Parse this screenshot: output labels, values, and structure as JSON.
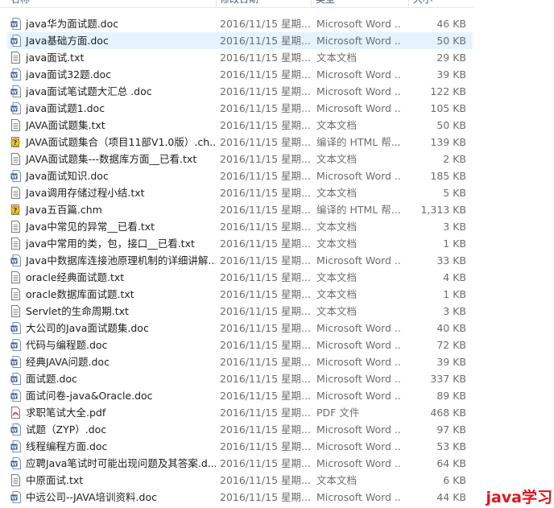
{
  "header": {
    "name_label": "名称",
    "date_label": "修改日期",
    "type_label": "类型",
    "size_label": "大小"
  },
  "files": [
    {
      "name": "java华为面试题.doc",
      "date": "2016/11/15 星期...",
      "type": "Microsoft Word ...",
      "size": "46 KB",
      "icon": "word-doc-icon",
      "selected": false
    },
    {
      "name": "Java基础方面.doc",
      "date": "2016/11/15 星期...",
      "type": "Microsoft Word ...",
      "size": "50 KB",
      "icon": "word-doc-icon",
      "selected": true
    },
    {
      "name": "java面试.txt",
      "date": "2016/11/15 星期...",
      "type": "文本文档",
      "size": "29 KB",
      "icon": "text-file-icon",
      "selected": false
    },
    {
      "name": "java面试32题.doc",
      "date": "2016/11/15 星期...",
      "type": "Microsoft Word ...",
      "size": "39 KB",
      "icon": "word-doc-icon",
      "selected": false
    },
    {
      "name": "java面试笔试题大汇总 .doc",
      "date": "2016/11/15 星期...",
      "type": "Microsoft Word ...",
      "size": "122 KB",
      "icon": "word-doc-icon",
      "selected": false
    },
    {
      "name": "java面试题1.doc",
      "date": "2016/11/15 星期...",
      "type": "Microsoft Word ...",
      "size": "105 KB",
      "icon": "word-doc-icon",
      "selected": false
    },
    {
      "name": "JAVA面试题集.txt",
      "date": "2016/11/15 星期...",
      "type": "文本文档",
      "size": "50 KB",
      "icon": "text-file-icon",
      "selected": false
    },
    {
      "name": "JAVA面试题集合（项目11部V1.0版）.ch...",
      "date": "2016/11/15 星期...",
      "type": "编译的 HTML 帮...",
      "size": "139 KB",
      "icon": "chm-help-icon",
      "selected": false
    },
    {
      "name": "JAVA面试题集---数据库方面__已看.txt",
      "date": "2016/11/15 星期...",
      "type": "文本文档",
      "size": "2 KB",
      "icon": "text-file-icon",
      "selected": false
    },
    {
      "name": "Java面试知识.doc",
      "date": "2016/11/15 星期...",
      "type": "Microsoft Word ...",
      "size": "185 KB",
      "icon": "word-doc-icon",
      "selected": false
    },
    {
      "name": "Java调用存储过程小结.txt",
      "date": "2016/11/15 星期...",
      "type": "文本文档",
      "size": "5 KB",
      "icon": "text-file-icon",
      "selected": false
    },
    {
      "name": "Java五百篇.chm",
      "date": "2016/11/15 星期...",
      "type": "编译的 HTML 帮...",
      "size": "1,313 KB",
      "icon": "chm-help-icon",
      "selected": false
    },
    {
      "name": "Java中常见的异常__已看.txt",
      "date": "2016/11/15 星期...",
      "type": "文本文档",
      "size": "3 KB",
      "icon": "text-file-icon",
      "selected": false
    },
    {
      "name": "java中常用的类，包，接口__已看.txt",
      "date": "2016/11/15 星期...",
      "type": "文本文档",
      "size": "1 KB",
      "icon": "text-file-icon",
      "selected": false
    },
    {
      "name": "Java中数据库连接池原理机制的详细讲解...",
      "date": "2016/11/15 星期...",
      "type": "Microsoft Word ...",
      "size": "33 KB",
      "icon": "word-doc-icon",
      "selected": false
    },
    {
      "name": "oracle经典面试题.txt",
      "date": "2016/11/15 星期...",
      "type": "文本文档",
      "size": "4 KB",
      "icon": "text-file-icon",
      "selected": false
    },
    {
      "name": "oracle数据库面试题.txt",
      "date": "2016/11/15 星期...",
      "type": "文本文档",
      "size": "1 KB",
      "icon": "text-file-icon",
      "selected": false
    },
    {
      "name": "Servlet的生命周期.txt",
      "date": "2016/11/15 星期...",
      "type": "文本文档",
      "size": "3 KB",
      "icon": "text-file-icon",
      "selected": false
    },
    {
      "name": "大公司的Java面试题集.doc",
      "date": "2016/11/15 星期...",
      "type": "Microsoft Word ...",
      "size": "40 KB",
      "icon": "word-doc-icon",
      "selected": false
    },
    {
      "name": "代码与编程题.doc",
      "date": "2016/11/15 星期...",
      "type": "Microsoft Word ...",
      "size": "72 KB",
      "icon": "word-doc-icon",
      "selected": false
    },
    {
      "name": "经典JAVA问题.doc",
      "date": "2016/11/15 星期...",
      "type": "Microsoft Word ...",
      "size": "39 KB",
      "icon": "word-doc-icon",
      "selected": false
    },
    {
      "name": "面试题.doc",
      "date": "2016/11/15 星期...",
      "type": "Microsoft Word ...",
      "size": "337 KB",
      "icon": "word-doc-icon",
      "selected": false
    },
    {
      "name": "面试问卷-java&Oracle.doc",
      "date": "2016/11/15 星期...",
      "type": "Microsoft Word ...",
      "size": "89 KB",
      "icon": "word-doc-icon",
      "selected": false
    },
    {
      "name": "求职笔试大全.pdf",
      "date": "2016/11/15 星期...",
      "type": "PDF 文件",
      "size": "468 KB",
      "icon": "pdf-file-icon",
      "selected": false
    },
    {
      "name": "试题（ZYP）.doc",
      "date": "2016/11/15 星期...",
      "type": "Microsoft Word ...",
      "size": "97 KB",
      "icon": "word-doc-icon",
      "selected": false
    },
    {
      "name": "线程编程方面.doc",
      "date": "2016/11/15 星期...",
      "type": "Microsoft Word ...",
      "size": "53 KB",
      "icon": "word-doc-icon",
      "selected": false
    },
    {
      "name": "应聘Java笔试时可能出现问题及其答案.d...",
      "date": "2016/11/15 星期...",
      "type": "Microsoft Word ...",
      "size": "64 KB",
      "icon": "word-doc-icon",
      "selected": false
    },
    {
      "name": "中原面试.txt",
      "date": "2016/11/15 星期...",
      "type": "文本文档",
      "size": "6 KB",
      "icon": "text-file-icon",
      "selected": false
    },
    {
      "name": "中远公司--JAVA培训资料.doc",
      "date": "2016/11/15 星期...",
      "type": "Microsoft Word ...",
      "size": "44 KB",
      "icon": "word-doc-icon",
      "selected": false
    }
  ],
  "watermark": {
    "text": "java学习"
  },
  "colors": {
    "selection": "#e5f3ff",
    "word_blue": "#2b579a",
    "watermark_red": "#e0141c"
  }
}
